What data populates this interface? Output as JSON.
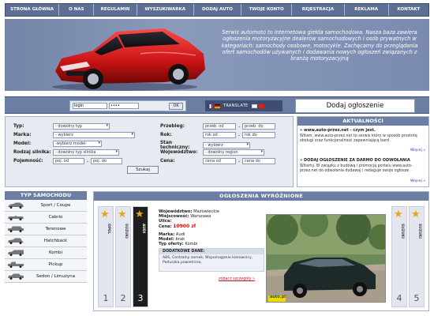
{
  "nav": [
    "STRONA GŁÓWNA",
    "O NAS",
    "REGULAMIN",
    "WYSZUKIWARKA",
    "DODAJ AUTO",
    "TWOJE KONTO",
    "REJESTRACJA",
    "REKLAMA",
    "KONTAKT"
  ],
  "hero": {
    "text": "Serwis automoto to internetowa giełda samochodowa. Nasza baza zawiera ogłoszenia motoryzacyjne dealerów samochodowych i osób prywatnych w kategoriach: samochody osobowe, motocykle. Zachęcamy do przeglądania ofert samochodów używanych i dodawania nowych ogłoszeń związanych z branżą motoryzacyjną"
  },
  "login": {
    "login_value": "login",
    "password_value": "••••",
    "button": "OK"
  },
  "translate_label": "TRANSLATE",
  "add_ad": "Dodaj ogłoszenie",
  "search": {
    "typ_label": "Typ:",
    "typ_value": "- dowolny typ",
    "marka_label": "Marka:",
    "marka_value": "- wybierz",
    "model_label": "Model:",
    "model_value": "-wybierz model-",
    "silnik_label": "Rodzaj silnika:",
    "silnik_value": "- dowolny typ silnika",
    "pojemnosc_label": "Pojemność:",
    "pojemnosc_od": "poj. od",
    "pojemnosc_do": "poj. do",
    "przebieg_label": "Przebieg:",
    "przebieg_od": "przeb. od",
    "przebieg_do": "przeb. do",
    "rok_label": "Rok:",
    "rok_od": "rok od",
    "rok_do": "rok do",
    "stan_label": "Stan techniczny:",
    "stan_value": "- wybierz",
    "woj_label": "Województwo:",
    "woj_value": "- dowolny region",
    "cena_label": "Cena:",
    "cena_od": "cena od",
    "cena_do": "cena do",
    "button": "Szukaj"
  },
  "news": {
    "title": "AKTUALNOŚCI",
    "items": [
      {
        "head": "» www.auto-przez.net - czym jest.",
        "body": "Witam, www.auto-przez.net to serwis który w sposób prostotę obsługi oraz funkcjonalność zapewniającą bard",
        "more": "Więcej »"
      },
      {
        "head": "» DODAJ OGŁOSZENIE ZA DARMO DO ODWOŁANIA",
        "body": "Witamy. W związku z budową i promocją portalu www.auto-przez.net do odwołania dodawaj i redaguje swoje ogłosze",
        "more": "Więcej »"
      }
    ]
  },
  "types": {
    "title": "TYP SAMOCHODU",
    "items": [
      "Sport / Coupe",
      "Cabrio",
      "Terenowe",
      "Hatchback",
      "Kombi",
      "Pickup",
      "Sedon / Limuzyna"
    ]
  },
  "featured": {
    "title": "OGŁOSZENIA WYRÓŻNIONE",
    "tabs": [
      {
        "label": "OPEL",
        "num": "1"
      },
      {
        "label": "SUZUKI",
        "num": "2"
      },
      {
        "label": "AUDI",
        "num": "3"
      },
      {
        "label": "SUZUKI",
        "num": "4"
      },
      {
        "label": "SUZUKI",
        "num": "5"
      }
    ],
    "woj_label": "Województwo:",
    "woj_value": "Mazowieckie",
    "miejsc_label": "Miejscowość:",
    "miejsc_value": "Warszawa",
    "ulica_label": "Ulica:",
    "cena_label": "Cena:",
    "cena_value": "10900 zł",
    "marka_label": "Marka:",
    "marka_value": "Audi",
    "model_label": "Model:",
    "model_value": "brak",
    "oferta_label": "Typ oferty:",
    "oferta_value": "Kombi",
    "extras_head": "DODATKOWE DANE:",
    "extras_text": "ABS, Centralny zamek, Wspomaganie kierownicy, Poduszka powietrzna,",
    "more": "zobacz szczegóły »",
    "watermark": "auto.pl"
  },
  "colors": {
    "nav_bg": "#5d6f94",
    "panel_header": "#6c7ea3",
    "price": "#dd1111",
    "star": "#e4a41c"
  }
}
